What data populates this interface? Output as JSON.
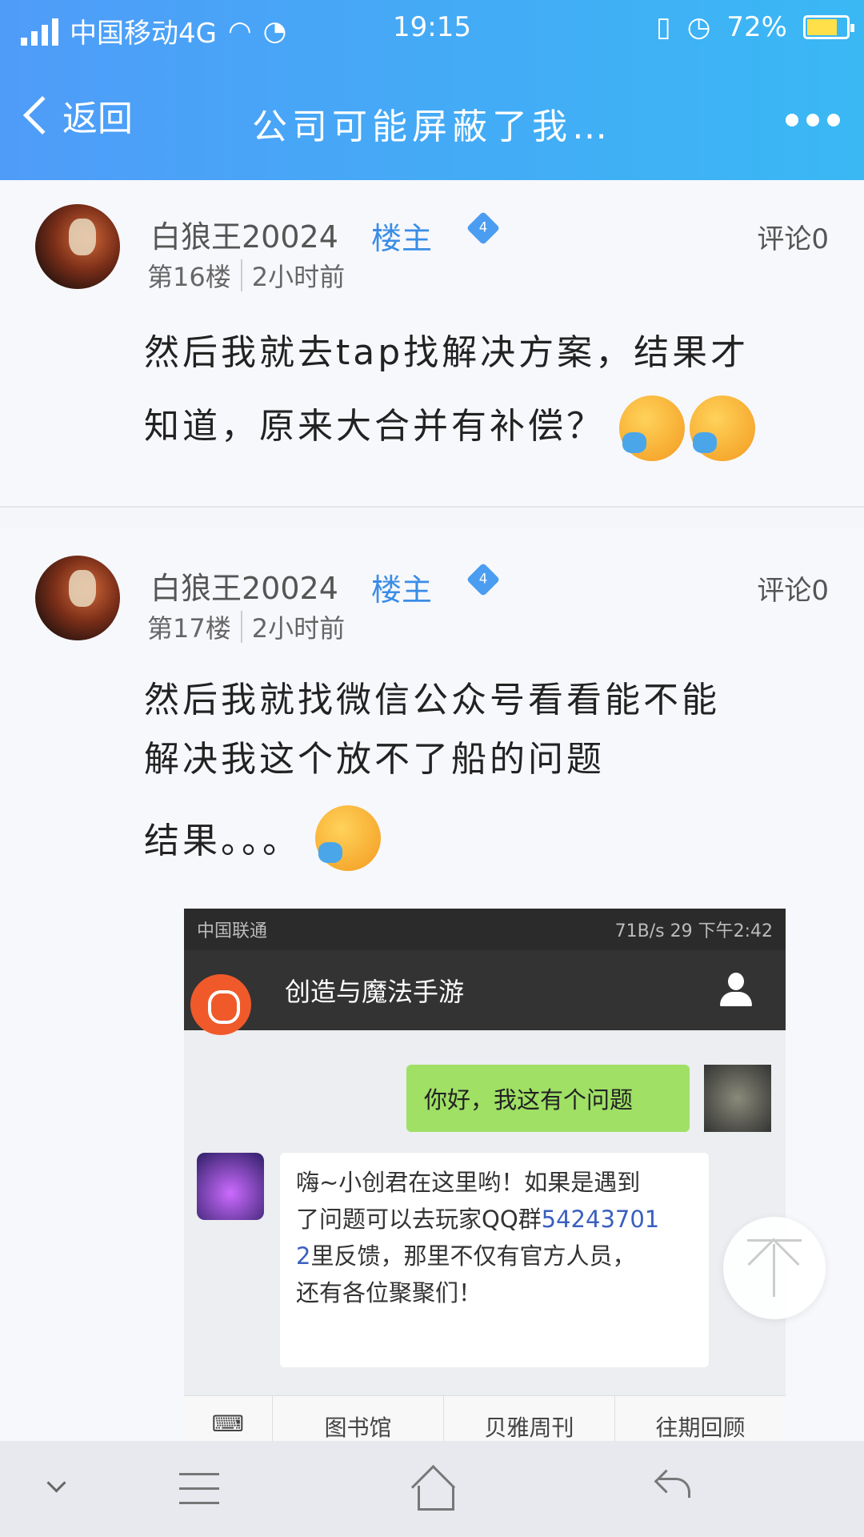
{
  "status_bar": {
    "carrier": "中国移动4G",
    "time": "19:15",
    "battery": "72%",
    "battery_level": 0.72
  },
  "nav": {
    "back_label": "返回",
    "title": "公司可能屏蔽了我…"
  },
  "posts": [
    {
      "username": "白狼王20024",
      "role": "楼主",
      "level": "4",
      "comments": "评论0",
      "floor": "第16楼",
      "time": "2小时前",
      "text_line1": "然后我就去tap找解决方案，结果才",
      "text_line2": "知道，原来大合并有补偿？"
    },
    {
      "username": "白狼王20024",
      "role": "楼主",
      "level": "4",
      "comments": "评论0",
      "floor": "第17楼",
      "time": "2小时前",
      "text_line1": "然后我就找微信公众号看看能不能",
      "text_line2": "解决我这个放不了船的问题",
      "text_line3": "结果。。。"
    }
  ],
  "screenshot": {
    "statusbar_left": "中国联通",
    "statusbar_right": "71B/s  29  下午2:42",
    "header_title": "创造与魔法手游",
    "msg_out": "你好，我这有个问题",
    "msg_in_1": "嗨~小创君在这里哟！如果是遇到",
    "msg_in_2a": "了问题可以去玩家QQ群",
    "msg_in_2b": "54243701",
    "msg_in_3a": "2",
    "msg_in_3b": "里反馈，那里不仅有官方人员，",
    "msg_in_4": "还有各位聚聚们！",
    "menu": [
      "图书馆",
      "贝雅周刊",
      "往期回顾"
    ]
  }
}
